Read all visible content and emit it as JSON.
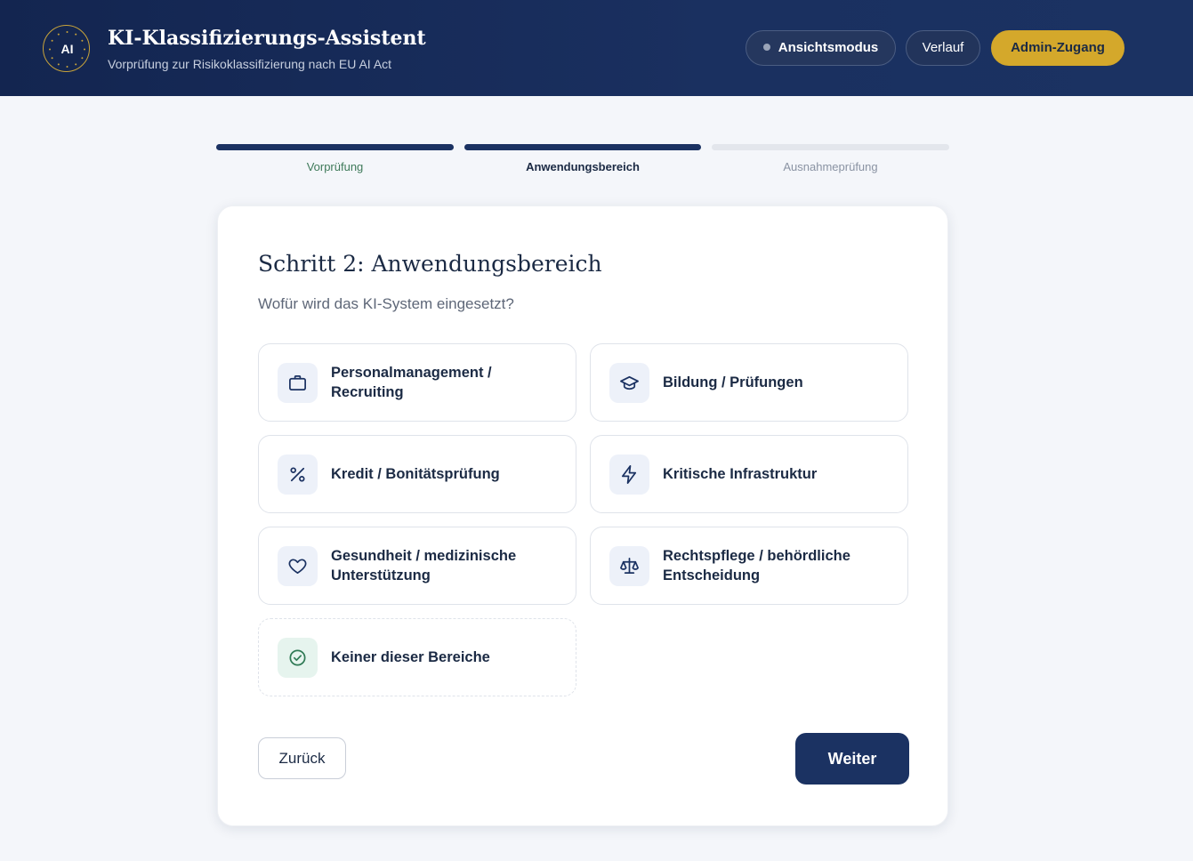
{
  "header": {
    "logo_text": "AI",
    "title": "KI-Klassifizierungs-Assistent",
    "subtitle": "Vorprüfung zur Risikoklassifizierung nach EU AI Act",
    "view_mode_label": "Ansichtsmodus",
    "history_label": "Verlauf",
    "admin_label": "Admin-Zugang"
  },
  "stepper": {
    "steps": [
      {
        "label": "Vorprüfung",
        "state": "completed"
      },
      {
        "label": "Anwendungsbereich",
        "state": "active"
      },
      {
        "label": "Ausnahmeprüfung",
        "state": "pending"
      }
    ]
  },
  "card": {
    "title": "Schritt 2: Anwendungsbereich",
    "question": "Wofür wird das KI-System eingesetzt?",
    "options": [
      {
        "label": "Personalmanagement / Recruiting",
        "icon": "briefcase-icon"
      },
      {
        "label": "Bildung / Prüfungen",
        "icon": "graduation-cap-icon"
      },
      {
        "label": "Kredit / Bonitätsprüfung",
        "icon": "percent-icon"
      },
      {
        "label": "Kritische Infrastruktur",
        "icon": "lightning-icon"
      },
      {
        "label": "Gesundheit / medizinische Unterstützung",
        "icon": "heart-icon"
      },
      {
        "label": "Rechtspflege / behördliche Entscheidung",
        "icon": "scales-icon"
      },
      {
        "label": "Keiner dieser Bereiche",
        "icon": "check-circle-icon"
      }
    ],
    "back_label": "Zurück",
    "next_label": "Weiter"
  },
  "colors": {
    "header_bg": "#1a3060",
    "accent_gold": "#d4a82b",
    "primary_navy": "#1b3262",
    "step_completed_text": "#3f7a5a",
    "step_pending_bar": "#e3e6ec"
  }
}
